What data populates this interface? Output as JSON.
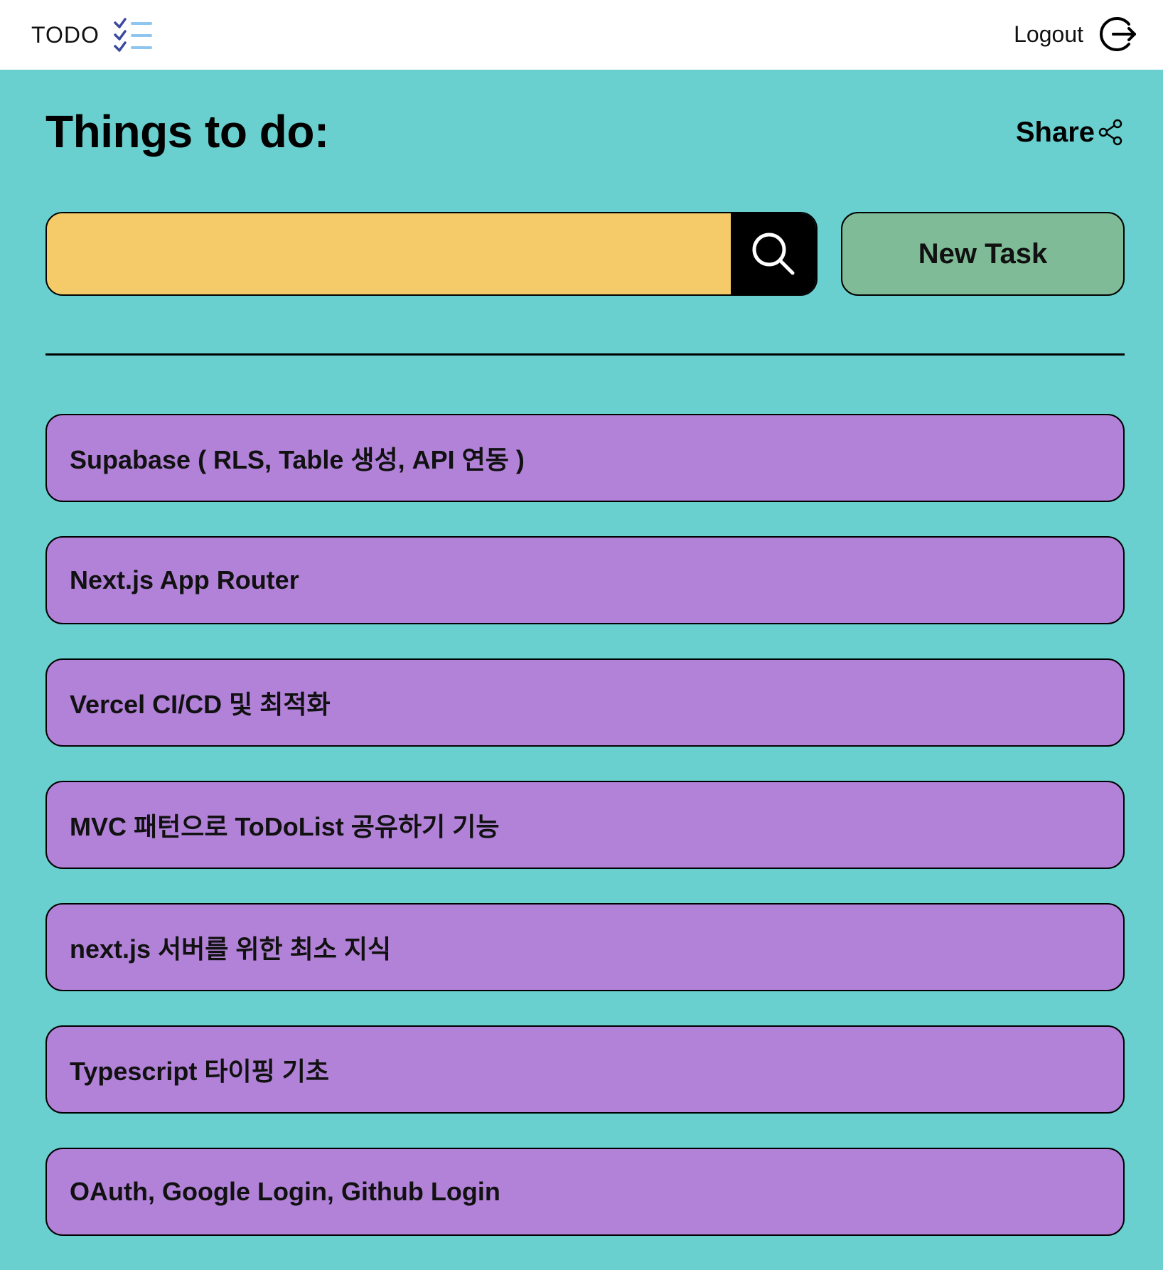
{
  "header": {
    "brand": "TODO",
    "brand_icon": "checklist-icon",
    "logout_label": "Logout",
    "logout_icon": "logout-icon"
  },
  "page": {
    "title": "Things to do:",
    "share_label": "Share",
    "share_icon": "share-icon"
  },
  "search": {
    "value": "",
    "placeholder": "",
    "button_icon": "search-icon"
  },
  "actions": {
    "new_task_label": "New Task"
  },
  "tasks": [
    {
      "label": "Supabase ( RLS, Table 생성, API 연동 )"
    },
    {
      "label": "Next.js App Router"
    },
    {
      "label": "Vercel CI/CD 및 최적화"
    },
    {
      "label": "MVC 패턴으로 ToDoList 공유하기 기능"
    },
    {
      "label": "next.js 서버를 위한 최소 지식"
    },
    {
      "label": "Typescript 타이핑 기초"
    },
    {
      "label": "OAuth, Google Login, Github Login"
    }
  ],
  "colors": {
    "background": "#69cfcf",
    "header_bg": "#ffffff",
    "search_bg": "#f4cb68",
    "new_task_bg": "#7fbb96",
    "task_bg": "#b282d9",
    "checklist_accent_dark": "#3b4a9c",
    "checklist_accent_light": "#8ec6f0"
  }
}
